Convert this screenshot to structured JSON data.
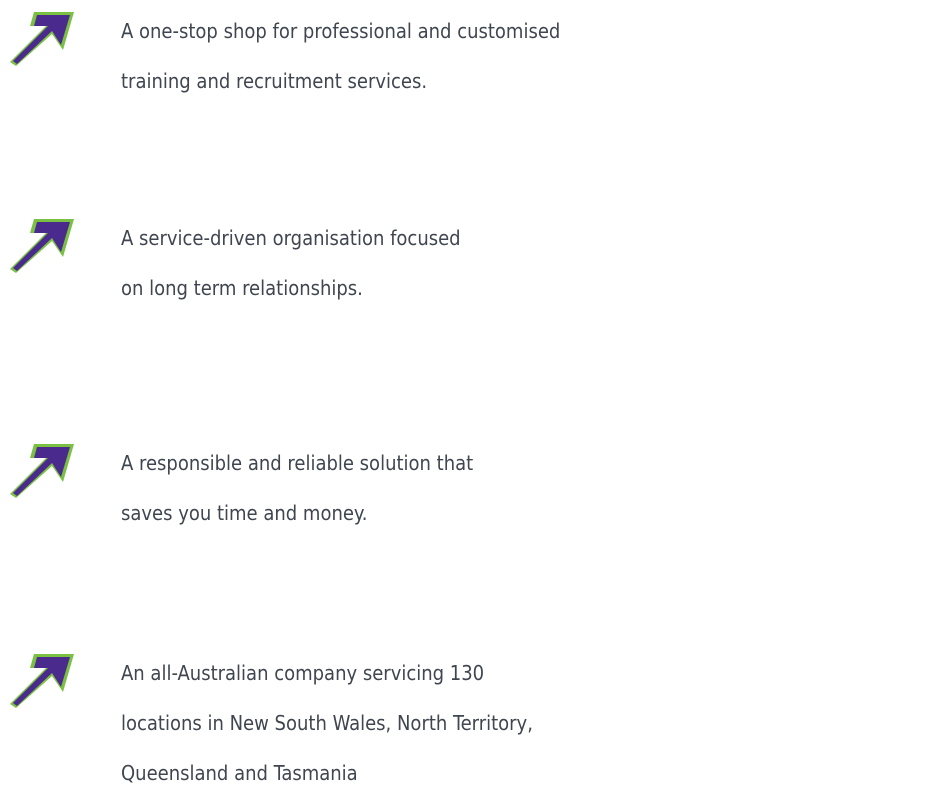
{
  "colors": {
    "arrow_fill": "#4b2a8e",
    "arrow_outline": "#7ac143",
    "text": "#3f4650"
  },
  "items": [
    {
      "icon": "diagonal-arrow-icon",
      "lines": [
        "A one-stop shop for professional and customised",
        "training and recruitment services."
      ]
    },
    {
      "icon": "diagonal-arrow-icon",
      "lines": [
        "A service-driven organisation focused",
        "on long term relationships."
      ]
    },
    {
      "icon": "diagonal-arrow-icon",
      "lines": [
        "A responsible and reliable solution that",
        "saves you time and money."
      ]
    },
    {
      "icon": "diagonal-arrow-icon",
      "lines": [
        "An all-Australian company servicing 130",
        "locations in New South Wales, North Territory,",
        "Queensland and Tasmania"
      ]
    }
  ]
}
